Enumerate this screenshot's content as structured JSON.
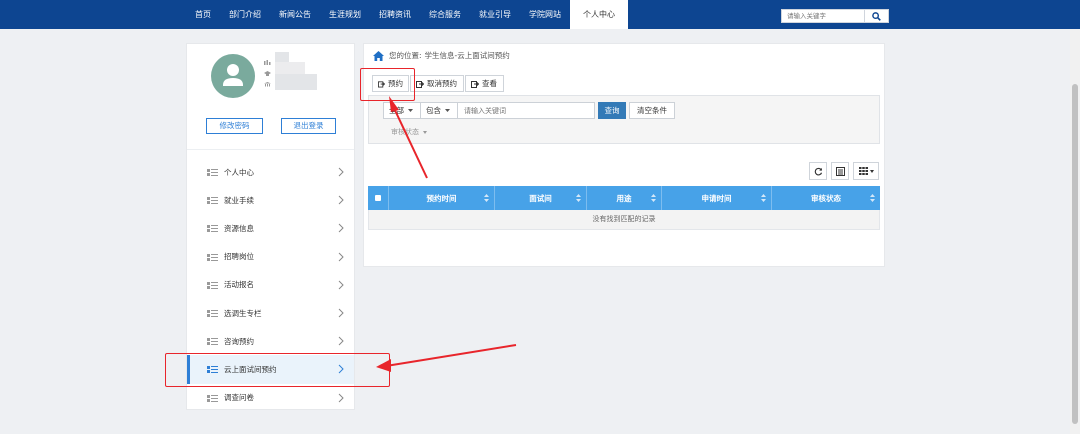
{
  "nav": {
    "items": [
      "首页",
      "部门介绍",
      "新闻公告",
      "生涯规划",
      "招聘资讯",
      "综合服务",
      "就业引导",
      "学院网站",
      "个人中心"
    ],
    "active_index": 8,
    "search_placeholder": "请输入关键字"
  },
  "profile": {
    "change_password": "修改密码",
    "logout": "退出登录"
  },
  "sidebar": {
    "items": [
      {
        "label": "个人中心"
      },
      {
        "label": "就业手续"
      },
      {
        "label": "资源信息"
      },
      {
        "label": "招聘岗位"
      },
      {
        "label": "活动报名"
      },
      {
        "label": "选调生专栏"
      },
      {
        "label": "咨询预约"
      },
      {
        "label": "云上面试间预约"
      },
      {
        "label": "调查问卷"
      }
    ],
    "active_index": 7
  },
  "breadcrumb": {
    "prefix": "您的位置:",
    "path": "学生信息-云上面试间预约"
  },
  "toolbar": {
    "reserve": "预约",
    "cancel": "取消预约",
    "view": "查看"
  },
  "filter": {
    "scope": "全部",
    "match": "包含",
    "keyword_placeholder": "请输入关键词",
    "query": "查询",
    "clear": "清空条件",
    "audit_status": "审核状态"
  },
  "table": {
    "columns": [
      "预约时间",
      "面试间",
      "用途",
      "申请时间",
      "审核状态"
    ],
    "empty_text": "没有找到匹配的记录"
  },
  "colors": {
    "nav_bg": "#0d4591",
    "table_header": "#47a2e8",
    "primary": "#337ab7",
    "accent": "#2e7fd6",
    "annotation": "#e8252b"
  }
}
